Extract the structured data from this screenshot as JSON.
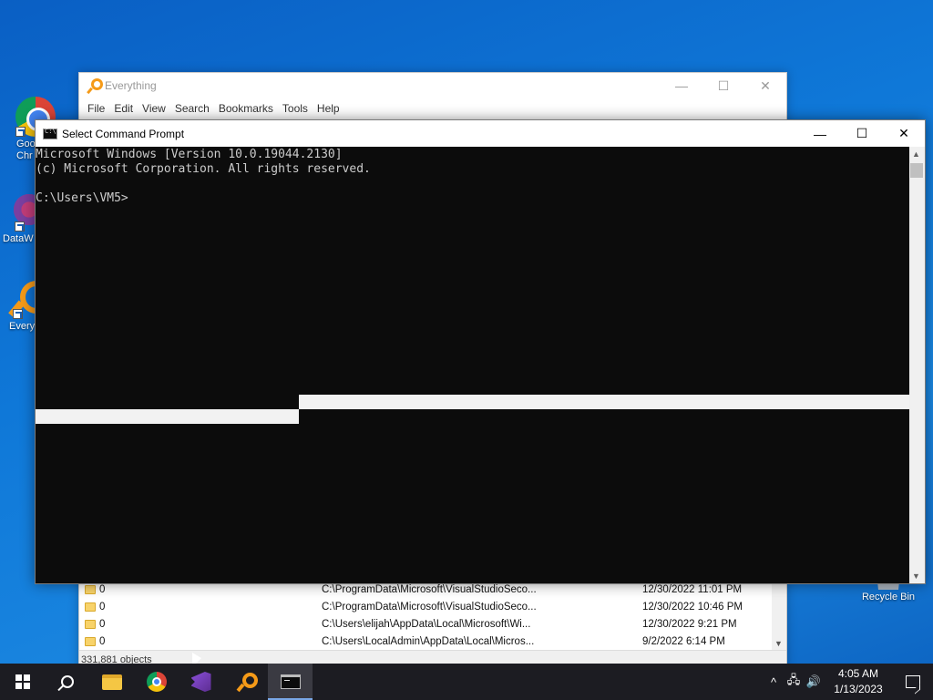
{
  "desktop": {
    "icons": [
      {
        "label": "Google Chrome",
        "visible_text": "Goo Chr",
        "icon": "chrome-icon"
      },
      {
        "label": "DataW",
        "icon": "datawrapper-icon"
      },
      {
        "label": "Every",
        "icon": "everything-icon"
      },
      {
        "label": "Recycle Bin",
        "icon": "recycle-bin-icon"
      }
    ]
  },
  "everything": {
    "title": "Everything",
    "menu": [
      "File",
      "Edit",
      "View",
      "Search",
      "Bookmarks",
      "Tools",
      "Help"
    ],
    "caption": {
      "minimize": "—",
      "maximize": "☐",
      "close": "✕"
    },
    "rows": [
      {
        "name": "0",
        "path": "C:\\ProgramData\\Microsoft\\VisualStudioSeco...",
        "date": "12/30/2022 11:01 PM"
      },
      {
        "name": "0",
        "path": "C:\\ProgramData\\Microsoft\\VisualStudioSeco...",
        "date": "12/30/2022 10:46 PM"
      },
      {
        "name": "0",
        "path": "C:\\Users\\elijah\\AppData\\Local\\Microsoft\\Wi...",
        "date": "12/30/2022 9:21 PM"
      },
      {
        "name": "0",
        "path": "C:\\Users\\LocalAdmin\\AppData\\Local\\Micros...",
        "date": "9/2/2022 6:14 PM"
      }
    ],
    "status": "331,881 objects"
  },
  "cmd": {
    "title": "Select Command Prompt",
    "caption": {
      "minimize": "—",
      "maximize": "☐",
      "close": "✕"
    },
    "lines": [
      "Microsoft Windows [Version 10.0.19044.2130]",
      "(c) Microsoft Corporation. All rights reserved.",
      "",
      "C:\\Users\\VM5>"
    ]
  },
  "taskbar": {
    "apps": [
      {
        "name": "start",
        "icon": "windows-logo-icon"
      },
      {
        "name": "search",
        "icon": "search-icon"
      },
      {
        "name": "file-explorer",
        "icon": "folder-icon"
      },
      {
        "name": "chrome",
        "icon": "chrome-icon"
      },
      {
        "name": "visual-studio",
        "icon": "visual-studio-icon"
      },
      {
        "name": "everything",
        "icon": "everything-icon"
      },
      {
        "name": "command-prompt",
        "icon": "cmd-icon",
        "active": true
      }
    ],
    "tray": {
      "chevron": "^",
      "network": "🖧",
      "volume": "🔊"
    },
    "clock": {
      "time": "4:05 AM",
      "date": "1/13/2023"
    }
  },
  "colors": {
    "desktop": "#0f78d8",
    "cmd_background": "#0c0c0c",
    "cmd_text": "#cccccc",
    "taskbar": "#1c1c22",
    "accent": "#f59a18"
  }
}
